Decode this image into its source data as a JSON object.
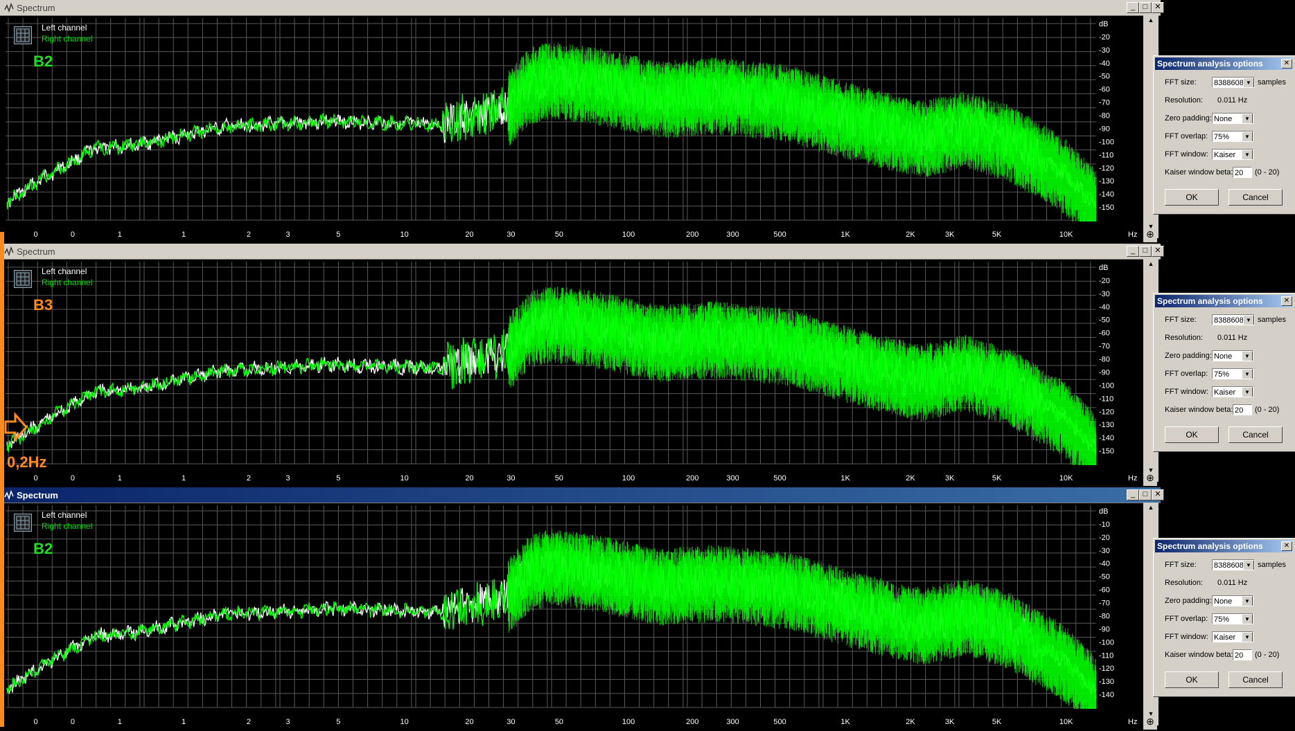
{
  "panels": [
    {
      "title": "Spectrum",
      "tag": "B2",
      "tag_color": "#22dd22",
      "active": false,
      "legend": {
        "left": "Left channel",
        "right": "Right channel"
      },
      "db_unit": "dB",
      "db_ticks": [
        "-20",
        "-30",
        "-40",
        "-50",
        "-60",
        "-70",
        "-80",
        "-90",
        "-100",
        "-110",
        "-120",
        "-130",
        "-140",
        "-150"
      ],
      "freq_ticks": [
        "0",
        "0",
        "1",
        "1",
        "2",
        "3",
        "5",
        "10",
        "20",
        "30",
        "50",
        "100",
        "200",
        "300",
        "500",
        "1K",
        "2K",
        "3K",
        "5K",
        "10K"
      ],
      "freq_unit": "Hz",
      "dialog": {
        "title": "Spectrum analysis options",
        "fft_size_label": "FFT size:",
        "fft_size_value": "8388608",
        "fft_size_unit": "samples",
        "resolution_label": "Resolution:",
        "resolution_value": "0.011 Hz",
        "zero_padding_label": "Zero padding:",
        "zero_padding_value": "None",
        "fft_overlap_label": "FFT overlap:",
        "fft_overlap_value": "75%",
        "fft_window_label": "FFT window:",
        "fft_window_value": "Kaiser",
        "kaiser_beta_label": "Kaiser window beta:",
        "kaiser_beta_value": "20",
        "kaiser_beta_range": "(0 - 20)",
        "ok_label": "OK",
        "cancel_label": "Cancel"
      }
    },
    {
      "title": "Spectrum",
      "tag": "B3",
      "tag_color": "#ff8a1e",
      "active": false,
      "legend": {
        "left": "Left channel",
        "right": "Right channel"
      },
      "db_unit": "dB",
      "db_ticks": [
        "-20",
        "-30",
        "-40",
        "-50",
        "-60",
        "-70",
        "-80",
        "-90",
        "-100",
        "-110",
        "-120",
        "-130",
        "-140",
        "-150"
      ],
      "freq_ticks": [
        "0",
        "0",
        "1",
        "1",
        "2",
        "3",
        "5",
        "10",
        "20",
        "30",
        "50",
        "100",
        "200",
        "300",
        "500",
        "1K",
        "2K",
        "3K",
        "5K",
        "10K"
      ],
      "freq_unit": "Hz",
      "dialog": {
        "title": "Spectrum analysis options",
        "fft_size_label": "FFT size:",
        "fft_size_value": "8388608",
        "fft_size_unit": "samples",
        "resolution_label": "Resolution:",
        "resolution_value": "0.011 Hz",
        "zero_padding_label": "Zero padding:",
        "zero_padding_value": "None",
        "fft_overlap_label": "FFT overlap:",
        "fft_overlap_value": "75%",
        "fft_window_label": "FFT window:",
        "fft_window_value": "Kaiser",
        "kaiser_beta_label": "Kaiser window beta:",
        "kaiser_beta_value": "20",
        "kaiser_beta_range": "(0 - 20)",
        "ok_label": "OK",
        "cancel_label": "Cancel"
      }
    },
    {
      "title": "Spectrum",
      "tag": "B2",
      "tag_color": "#22dd22",
      "active": true,
      "legend": {
        "left": "Left channel",
        "right": "Right channel"
      },
      "db_unit": "dB",
      "db_ticks": [
        "-10",
        "-20",
        "-30",
        "-40",
        "-50",
        "-60",
        "-70",
        "-80",
        "-90",
        "-100",
        "-110",
        "-120",
        "-130",
        "-140"
      ],
      "freq_ticks": [
        "0",
        "0",
        "1",
        "1",
        "2",
        "3",
        "5",
        "10",
        "20",
        "30",
        "50",
        "100",
        "200",
        "300",
        "500",
        "1K",
        "2K",
        "3K",
        "5K",
        "10K"
      ],
      "freq_unit": "Hz",
      "dialog": {
        "title": "Spectrum analysis options",
        "fft_size_label": "FFT size:",
        "fft_size_value": "8388608",
        "fft_size_unit": "samples",
        "resolution_label": "Resolution:",
        "resolution_value": "0.011 Hz",
        "zero_padding_label": "Zero padding:",
        "zero_padding_value": "None",
        "fft_overlap_label": "FFT overlap:",
        "fft_overlap_value": "75%",
        "fft_window_label": "FFT window:",
        "fft_window_value": "Kaiser",
        "kaiser_beta_label": "Kaiser window beta:",
        "kaiser_beta_value": "20",
        "kaiser_beta_range": "(0 - 20)",
        "ok_label": "OK",
        "cancel_label": "Cancel"
      }
    }
  ],
  "annotation": {
    "text": "0,2Hz",
    "color": "#ff8a1e"
  },
  "colors": {
    "left_channel": "#ffffff",
    "right_channel": "#00ff00",
    "grid": "#5a5a5a",
    "background": "#000000"
  }
}
